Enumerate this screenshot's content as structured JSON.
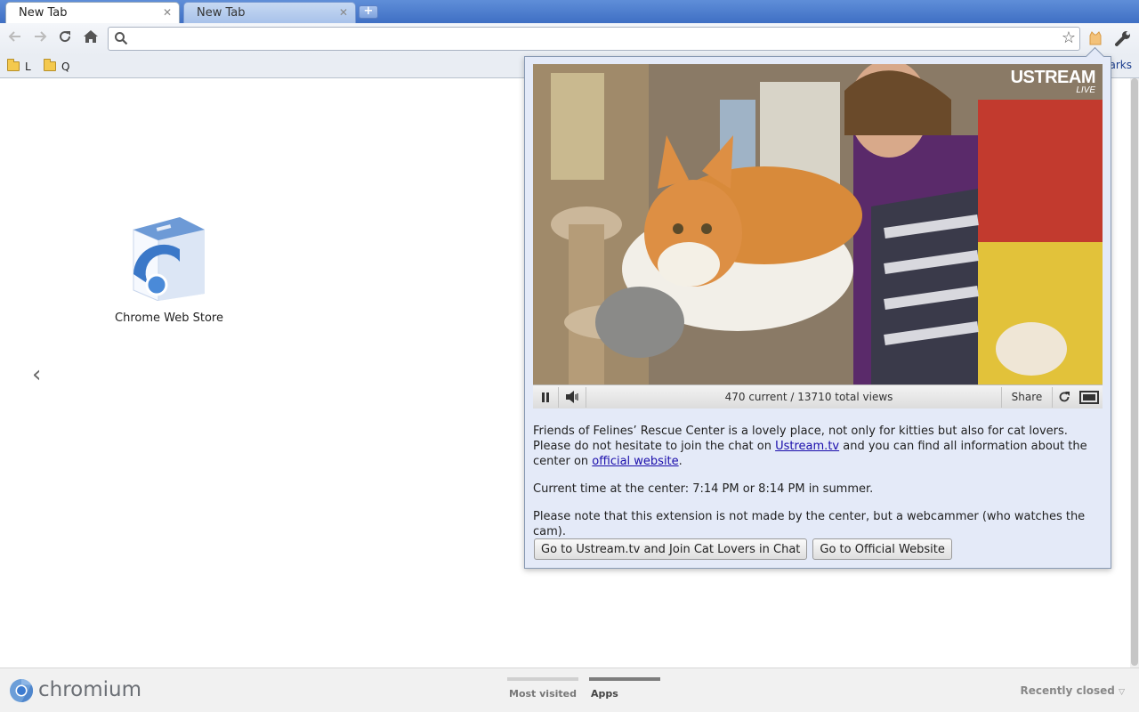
{
  "tabs": [
    {
      "title": "New Tab",
      "active": true
    },
    {
      "title": "New Tab",
      "active": false
    }
  ],
  "toolbar": {
    "back_icon": "back-arrow-icon",
    "forward_icon": "forward-arrow-icon",
    "reload_icon": "reload-icon",
    "home_icon": "home-icon",
    "omnibox_value": "",
    "bookmark_star_icon": "star-icon",
    "extension_icon": "cat-extension-icon",
    "wrench_icon": "wrench-icon"
  },
  "bookmarks": {
    "items": [
      {
        "label": "L"
      },
      {
        "label": "Q"
      }
    ],
    "other_label": "arks"
  },
  "apps": [
    {
      "label": "Chrome Web Store"
    }
  ],
  "popup": {
    "stream_brand": "USTREAM",
    "stream_status": "LIVE",
    "views_text": "470 current / 13710 total views",
    "share_label": "Share",
    "paragraph1_a": "Friends of Felines’ Rescue Center is a lovely place, not only for kitties but also for cat lovers. Please do not hesitate to join the chat on ",
    "paragraph1_link1": "Ustream.tv",
    "paragraph1_b": " and you can find all information about the center on ",
    "paragraph1_link2": "official website",
    "paragraph1_c": ".",
    "paragraph2": "Current time at the center: 7:14 PM or 8:14 PM in summer.",
    "paragraph3": "Please note that this extension is not made by the center, but a webcammer (who watches the cam).",
    "button_chat": "Go to Ustream.tv and Join Cat Lovers in Chat",
    "button_website": "Go to Official Website"
  },
  "footer": {
    "brand": "chromium",
    "tabs": [
      {
        "label": "Most visited",
        "selected": false
      },
      {
        "label": "Apps",
        "selected": true
      }
    ],
    "recently_closed": "Recently closed"
  },
  "colors": {
    "tabstrip": "#3f6fc4",
    "popup_bg": "#e4eaf8",
    "link": "#1a0dab"
  }
}
